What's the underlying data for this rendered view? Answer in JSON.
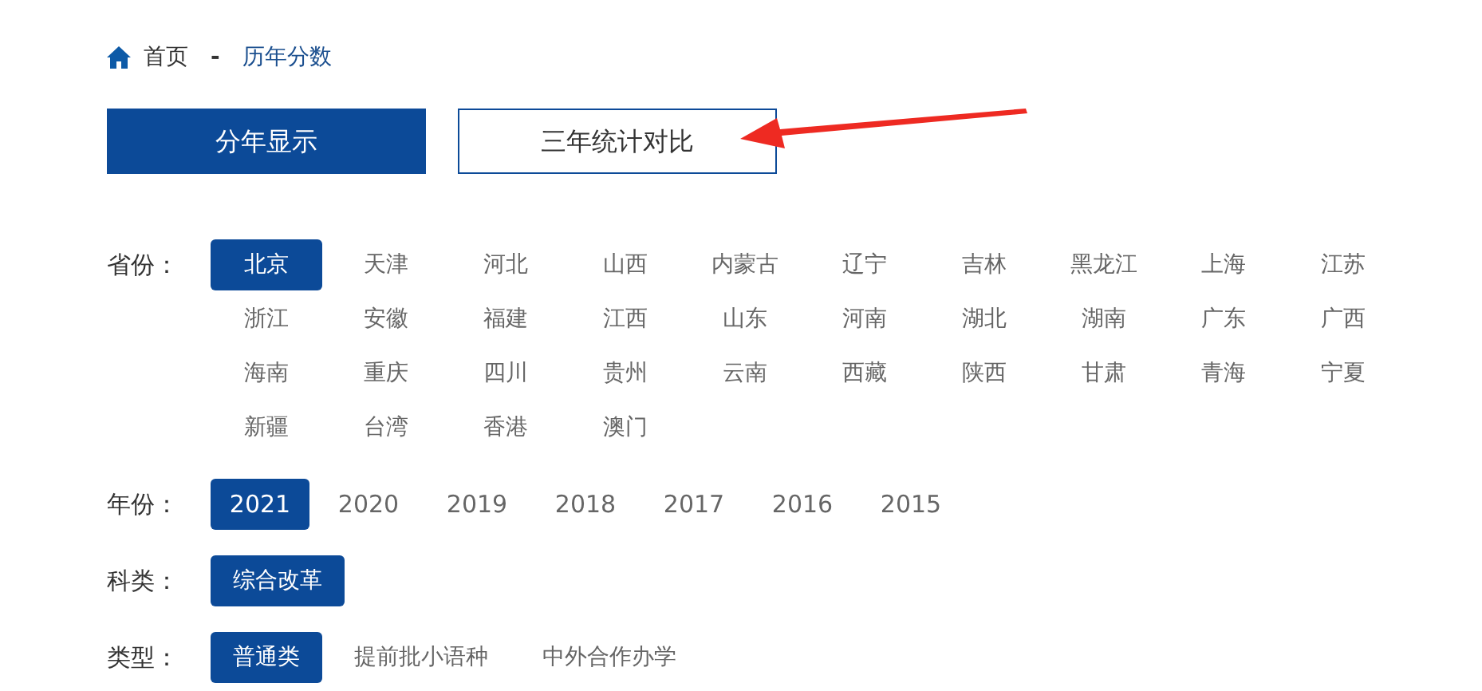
{
  "breadcrumb": [
    {
      "label": "首页",
      "kind": "home"
    },
    {
      "label": "历年分数",
      "kind": "current"
    }
  ],
  "breadcrumb_separator": "-",
  "view_tabs": [
    {
      "label": "分年显示",
      "selected": true
    },
    {
      "label": "三年统计对比",
      "selected": false
    }
  ],
  "filters": [
    {
      "label": "省份：",
      "kind": "grid",
      "options": [
        {
          "label": "北京",
          "selected": true
        },
        {
          "label": "天津",
          "selected": false
        },
        {
          "label": "河北",
          "selected": false
        },
        {
          "label": "山西",
          "selected": false
        },
        {
          "label": "内蒙古",
          "selected": false
        },
        {
          "label": "辽宁",
          "selected": false
        },
        {
          "label": "吉林",
          "selected": false
        },
        {
          "label": "黑龙江",
          "selected": false
        },
        {
          "label": "上海",
          "selected": false
        },
        {
          "label": "江苏",
          "selected": false
        },
        {
          "label": "浙江",
          "selected": false
        },
        {
          "label": "安徽",
          "selected": false
        },
        {
          "label": "福建",
          "selected": false
        },
        {
          "label": "江西",
          "selected": false
        },
        {
          "label": "山东",
          "selected": false
        },
        {
          "label": "河南",
          "selected": false
        },
        {
          "label": "湖北",
          "selected": false
        },
        {
          "label": "湖南",
          "selected": false
        },
        {
          "label": "广东",
          "selected": false
        },
        {
          "label": "广西",
          "selected": false
        },
        {
          "label": "海南",
          "selected": false
        },
        {
          "label": "重庆",
          "selected": false
        },
        {
          "label": "四川",
          "selected": false
        },
        {
          "label": "贵州",
          "selected": false
        },
        {
          "label": "云南",
          "selected": false
        },
        {
          "label": "西藏",
          "selected": false
        },
        {
          "label": "陕西",
          "selected": false
        },
        {
          "label": "甘肃",
          "selected": false
        },
        {
          "label": "青海",
          "selected": false
        },
        {
          "label": "宁夏",
          "selected": false
        },
        {
          "label": "新疆",
          "selected": false
        },
        {
          "label": "台湾",
          "selected": false
        },
        {
          "label": "香港",
          "selected": false
        },
        {
          "label": "澳门",
          "selected": false
        }
      ]
    },
    {
      "label": "年份：",
      "kind": "fixed",
      "options": [
        {
          "label": "2021",
          "selected": true
        },
        {
          "label": "2020",
          "selected": false
        },
        {
          "label": "2019",
          "selected": false
        },
        {
          "label": "2018",
          "selected": false
        },
        {
          "label": "2017",
          "selected": false
        },
        {
          "label": "2016",
          "selected": false
        },
        {
          "label": "2015",
          "selected": false
        }
      ]
    },
    {
      "label": "科类：",
      "kind": "auto",
      "options": [
        {
          "label": "综合改革",
          "selected": true
        }
      ]
    },
    {
      "label": "类型：",
      "kind": "auto",
      "options": [
        {
          "label": "普通类",
          "selected": true
        },
        {
          "label": "提前批小语种",
          "selected": false
        },
        {
          "label": "中外合作办学",
          "selected": false
        }
      ]
    }
  ],
  "annotation": {
    "kind": "arrow"
  }
}
